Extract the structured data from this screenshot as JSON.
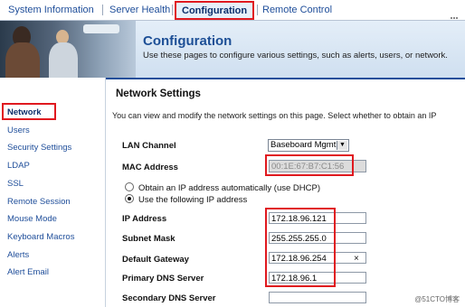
{
  "tabs": [
    {
      "label": "System Information",
      "active": false
    },
    {
      "label": "Server Health",
      "active": false
    },
    {
      "label": "Configuration",
      "active": true
    },
    {
      "label": "Remote Control",
      "active": false
    }
  ],
  "banner": {
    "title": "Configuration",
    "description": "Use these pages to configure various settings, such as alerts, users, or network."
  },
  "sidebar": {
    "items": [
      {
        "label": "Network",
        "active": true
      },
      {
        "label": "Users"
      },
      {
        "label": "Security Settings"
      },
      {
        "label": "LDAP"
      },
      {
        "label": "SSL"
      },
      {
        "label": "Remote Session"
      },
      {
        "label": "Mouse Mode"
      },
      {
        "label": "Keyboard Macros"
      },
      {
        "label": "Alerts"
      },
      {
        "label": "Alert Email"
      }
    ]
  },
  "main": {
    "title": "Network Settings",
    "intro": "You can view and modify the network settings on this page. Select whether to obtain an IP",
    "lan_channel": {
      "label": "LAN Channel",
      "value": "Baseboard Mgmt"
    },
    "mac_address": {
      "label": "MAC Address",
      "value": "00:1E:67:B7:C1:56"
    },
    "ip_mode": {
      "dhcp_label": "Obtain an IP address automatically (use DHCP)",
      "static_label": "Use the following IP address",
      "selected": "static"
    },
    "ip_address": {
      "label": "IP Address",
      "value": "172.18.96.121"
    },
    "subnet_mask": {
      "label": "Subnet Mask",
      "value": "255.255.255.0"
    },
    "default_gateway": {
      "label": "Default Gateway",
      "value": "172.18.96.254",
      "clear": "×"
    },
    "primary_dns": {
      "label": "Primary DNS Server",
      "value": "172.18.96.1"
    },
    "secondary_dns": {
      "label": "Secondary DNS Server",
      "value": ""
    }
  },
  "watermark": "@51CTO博客",
  "colors": {
    "accent": "#1f4e9a",
    "highlight": "#e0191f"
  }
}
